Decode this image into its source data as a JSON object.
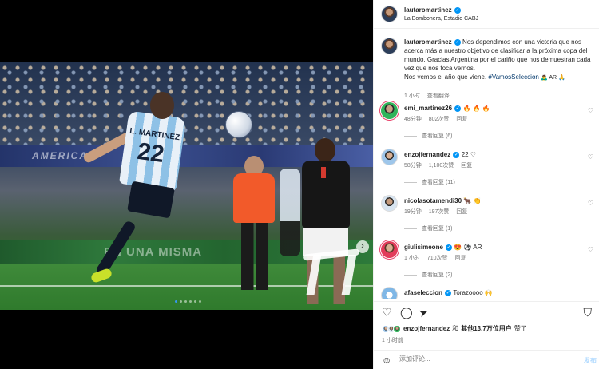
{
  "post": {
    "username": "lautaromartinez",
    "location": "La Bombonera, Estadio CABJ"
  },
  "media": {
    "jersey_name": "L. MARTINEZ",
    "jersey_number": "22",
    "ad_text_top": "AMERICAS",
    "ad_text_bottom": "EN UNA MISMA",
    "next_icon": "›",
    "dot_count": 6,
    "active_dot": 0
  },
  "caption": {
    "username": "lautaromartinez",
    "text": "Nos dependimos con una victoria que nos acerca más a nuestro objetivo de clasificar a la próxima copa del mundo. Gracias Argentina por el cariño que nos demuestran cada vez que nos toca vernos.",
    "line2": "Nos vemos el año que viene.",
    "hashtag": "#VamosSeleccion",
    "emoji": "🙇‍♂️ AR 🙏",
    "time": "1 小时",
    "translate": "查看翻译"
  },
  "comments": [
    {
      "username": "emi_martinez26",
      "text": "🔥 🔥 🔥",
      "time": "48分钟",
      "likes": "802次赞",
      "reply": "回复",
      "view_replies": "查看回复 (6)"
    },
    {
      "username": "enzojfernandez",
      "text": "22 ♡",
      "time": "58分钟",
      "likes": "1,100次赞",
      "reply": "回复",
      "view_replies": "查看回复 (11)"
    },
    {
      "username": "nicolasotamendi30",
      "text": "🐂 👏",
      "time": "19分钟",
      "likes": "197次赞",
      "reply": "回复",
      "view_replies": "查看回复 (1)"
    },
    {
      "username": "giulisimeone",
      "text": "😍 ⚽ AR",
      "time": "1 小时",
      "likes": "710次赞",
      "reply": "回复",
      "view_replies": "查看回复 (2)"
    },
    {
      "username": "afaseleccion",
      "text": "Torazoooo 🙌",
      "time": "",
      "likes": "",
      "reply": "",
      "view_replies": ""
    }
  ],
  "actions": {
    "like_icon": "♡",
    "comment_icon": "◯",
    "share_icon": "➤",
    "save_icon": "⛉"
  },
  "likes_summary": {
    "user": "enzojfernandez",
    "connector": "和",
    "others": "其他13.7万位用户",
    "suffix": "赞了"
  },
  "time_ago": "1 小时前",
  "add_comment": {
    "emoji_icon": "☺",
    "placeholder": "添加评论...",
    "post_label": "发布"
  },
  "icons": {
    "verified": "✓",
    "heart_small": "♡"
  },
  "colors": {
    "verified": "#0095f6",
    "hashtag": "#00376b",
    "muted": "#737373",
    "active_dot": "#3797f0"
  }
}
